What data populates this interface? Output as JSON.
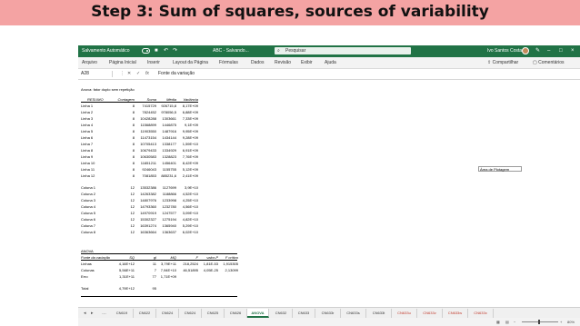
{
  "slide_title": "Step 3: Sum of squares, sources of variability",
  "titlebar": {
    "autosave_label": "Salvamento Automático",
    "filename": "ABC - Salvando...",
    "search_placeholder": "Pesquisar",
    "user_name": "Ivo Santos Costa"
  },
  "ribbon": {
    "tabs": [
      "Arquivo",
      "Página Inicial",
      "Inserir",
      "Layout da Página",
      "Fórmulas",
      "Dados",
      "Revisão",
      "Exibir",
      "Ajuda"
    ],
    "share_label": "Compartilhar",
    "comments_label": "Comentários"
  },
  "formula_bar": {
    "name_box": "A28",
    "formula": "Fonte da variação"
  },
  "sheet": {
    "heading": "Anova: fator duplo sem repetição",
    "summary_header": [
      "RESUMO",
      "Contagem",
      "Soma",
      "Média",
      "Variância"
    ],
    "row_groups": [
      [
        "Linha 1",
        "8",
        "7415729",
        "926715,8",
        "8,17E+09"
      ],
      [
        "Linha 2",
        "8",
        "7824452",
        "978056,5",
        "6,88E+09"
      ],
      [
        "Linha 3",
        "8",
        "10428288",
        "1303661",
        "7,33E+09"
      ],
      [
        "Linha 4",
        "8",
        "11568899",
        "1446875",
        "9,1E+09"
      ],
      [
        "Linha 5",
        "8",
        "11903550",
        "1487916",
        "9,95E+09"
      ],
      [
        "Linha 6",
        "8",
        "11473154",
        "1434144",
        "9,28E+09"
      ],
      [
        "Linha 7",
        "8",
        "10705413",
        "1338177",
        "1,59E+10"
      ],
      [
        "Linha 8",
        "8",
        "10679433",
        "1334929",
        "6,91E+09"
      ],
      [
        "Linha 9",
        "8",
        "10630583",
        "1328823",
        "7,76E+09"
      ],
      [
        "Linha 10",
        "8",
        "11651211",
        "1456401",
        "8,42E+09"
      ],
      [
        "Linha 11",
        "8",
        "9246043",
        "1155755",
        "5,12E+09"
      ],
      [
        "Linha 12",
        "8",
        "7081853",
        "885231,6",
        "2,41E+09"
      ]
    ],
    "column_groups": [
      [
        "Coluna 1",
        "12",
        "13532386",
        "1127699",
        "3,9E+10"
      ],
      [
        "Coluna 2",
        "12",
        "14263382",
        "1188866",
        "4,52E+10"
      ],
      [
        "Coluna 3",
        "12",
        "14807976",
        "1233998",
        "4,25E+10"
      ],
      [
        "Coluna 4",
        "12",
        "14793360",
        "1232780",
        "4,56E+10"
      ],
      [
        "Coluna 5",
        "12",
        "14970919",
        "1247577",
        "3,09E+10"
      ],
      [
        "Coluna 6",
        "12",
        "15302327",
        "1275194",
        "4,82E+10"
      ],
      [
        "Coluna 7",
        "12",
        "16391274",
        "1365940",
        "5,29E+10"
      ],
      [
        "Coluna 8",
        "12",
        "16363664",
        "1363637",
        "6,02E+10"
      ]
    ],
    "anova_label": "ANOVA",
    "anova_header": [
      "Fonte da variação",
      "SQ",
      "gl",
      "MQ",
      "F",
      "valor-P",
      "F crítico"
    ],
    "anova_rows": [
      [
        "Linhas",
        "4,16E+12",
        "11",
        "3,79E+11",
        "218,2524",
        "1,81E-53",
        "1,915305"
      ],
      [
        "Colunas",
        "5,56E+11",
        "7",
        "7,94E+10",
        "46,51895",
        "4,05E-25",
        "2,13099"
      ],
      [
        "Erro",
        "1,31E+11",
        "77",
        "1,71E+09",
        "",
        "",
        ""
      ],
      [
        "Total",
        "4,79E+12",
        "95",
        "",
        "",
        "",
        ""
      ]
    ],
    "plot_area_tooltip": "Área de Plotagem"
  },
  "sheet_tabs": [
    "CN619",
    "CN622",
    "CN624",
    "CN624",
    "CN625",
    "CN626",
    "ANOVA",
    "CN632",
    "CN633",
    "CN633r",
    "CN633s",
    "CN633t",
    "CN633u",
    "CN633v",
    "CN633w",
    "CN633x"
  ],
  "active_tab": "ANOVA",
  "colors": {
    "banner": "#f4a3a3",
    "excel_green": "#217346",
    "tab_red_text": "#c0392b"
  },
  "status": {
    "zoom": "80%"
  }
}
